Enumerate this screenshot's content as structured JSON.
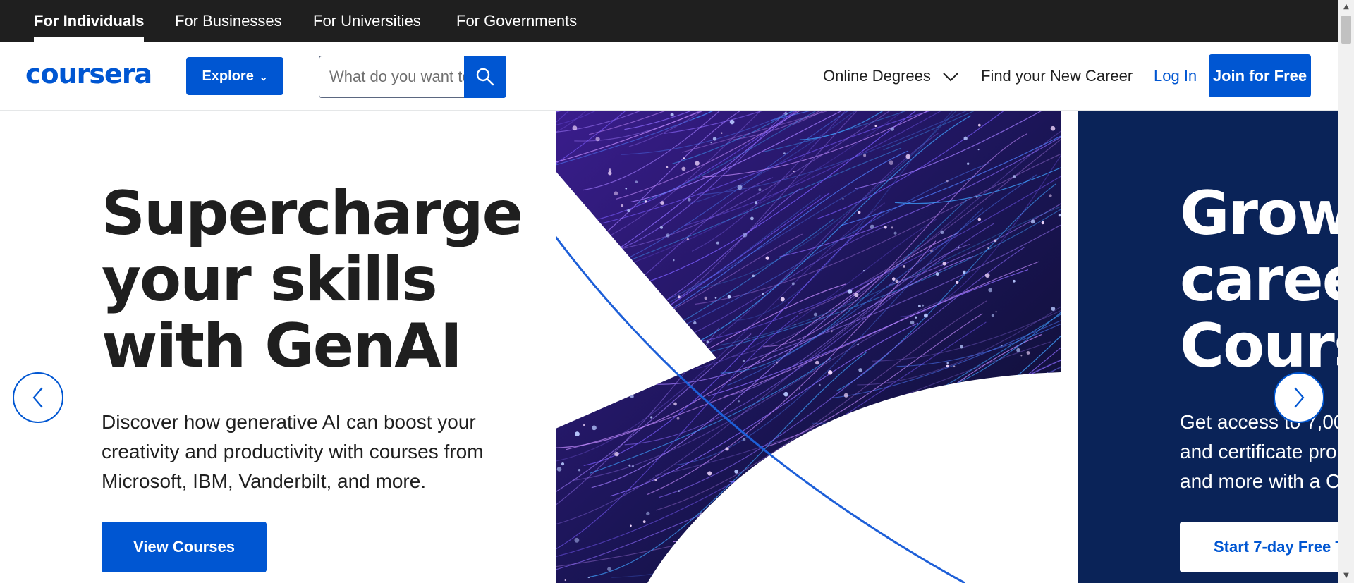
{
  "topbar": {
    "segments": [
      {
        "prefix": "For ",
        "emph": "Individuals",
        "active": true
      },
      {
        "label": "For Businesses"
      },
      {
        "label": "For Universities"
      },
      {
        "label": "For Governments"
      }
    ]
  },
  "header": {
    "logo": "coursera",
    "explore_label": "Explore",
    "search_placeholder": "What do you want to learn?",
    "nav": {
      "online_degrees": "Online Degrees",
      "find_career": "Find your New Career",
      "login": "Log In",
      "join": "Join for Free"
    }
  },
  "hero": {
    "slide1": {
      "title": "Supercharge your skills with GenAI",
      "description": "Discover how generative AI can boost your creativity and productivity with courses from Microsoft, IBM, Vanderbilt, and more.",
      "cta": "View Courses"
    },
    "slide2": {
      "title_lines": [
        "Grow",
        "caree",
        "Cours"
      ],
      "desc_lines": [
        "Get access to 7,00",
        "and certificate pro",
        "and more with a C"
      ],
      "cta": "Start 7-day Free T"
    }
  },
  "colors": {
    "brand": "#0056d2",
    "topbar": "#1f1f1f",
    "navy": "#0a2358"
  }
}
